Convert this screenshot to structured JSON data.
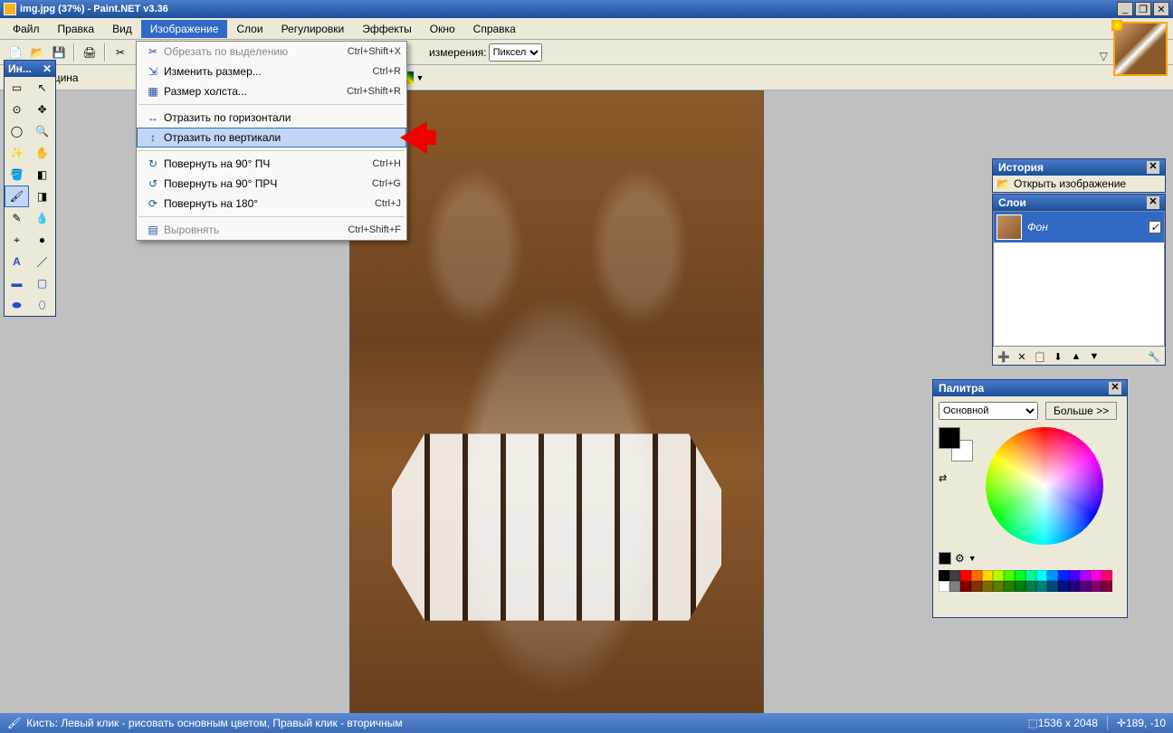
{
  "title": "img.jpg (37%) - Paint.NET v3.36",
  "menu": {
    "file": "Файл",
    "edit": "Правка",
    "view": "Вид",
    "image": "Изображение",
    "layers": "Слои",
    "adjust": "Регулировки",
    "effects": "Эффекты",
    "window": "Окно",
    "help": "Справка"
  },
  "secondary_toolbar": {
    "thickness_label": "Толщина",
    "measure_label": "измерения:",
    "unit": "Пиксел"
  },
  "toolbox": {
    "title": "Ин..."
  },
  "image_menu": {
    "crop": {
      "text": "Обрезать по выделению",
      "shortcut": "Ctrl+Shift+X"
    },
    "resize": {
      "text": "Изменить размер...",
      "shortcut": "Ctrl+R"
    },
    "canvas_size": {
      "text": "Размер холста...",
      "shortcut": "Ctrl+Shift+R"
    },
    "flip_h": {
      "text": "Отразить по горизонтали",
      "shortcut": ""
    },
    "flip_v": {
      "text": "Отразить по вертикали",
      "shortcut": ""
    },
    "rotate_cw": {
      "text": "Повернуть на 90° ПЧ",
      "shortcut": "Ctrl+H"
    },
    "rotate_ccw": {
      "text": "Повернуть на 90° ПРЧ",
      "shortcut": "Ctrl+G"
    },
    "rotate_180": {
      "text": "Повернуть на 180°",
      "shortcut": "Ctrl+J"
    },
    "flatten": {
      "text": "Выровнять",
      "shortcut": "Ctrl+Shift+F"
    }
  },
  "history": {
    "title": "История",
    "open_image": "Открыть изображение"
  },
  "layers": {
    "title": "Слои",
    "background": "Фон"
  },
  "palette": {
    "title": "Палитра",
    "primary": "Основной",
    "more": "Больше >>",
    "swatches": [
      "#000000",
      "#404040",
      "#ff0000",
      "#ff6a00",
      "#ffd800",
      "#b6ff00",
      "#4cff00",
      "#00ff21",
      "#00ff90",
      "#00ffff",
      "#0094ff",
      "#0026ff",
      "#4800ff",
      "#b200ff",
      "#ff00dc",
      "#ff006e",
      "#ffffff",
      "#808080",
      "#7f0000",
      "#7f3300",
      "#7f6a00",
      "#5b7f00",
      "#267f00",
      "#007f0e",
      "#007f46",
      "#007f7f",
      "#004a7f",
      "#00137f",
      "#24007f",
      "#57007f",
      "#7f006e",
      "#7f0037"
    ]
  },
  "statusbar": {
    "hint": "Кисть: Левый клик - рисовать основным цветом, Правый клик - вторичным",
    "dims": "1536 x 2048",
    "pos": "189, -10"
  }
}
